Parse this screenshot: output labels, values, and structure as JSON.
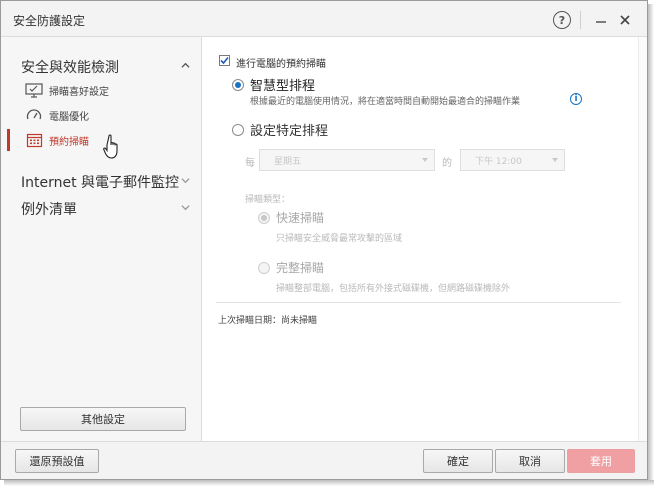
{
  "window": {
    "title": "安全防護設定"
  },
  "sidebar": {
    "sections": [
      {
        "label": "安全與效能檢測",
        "expanded": true,
        "items": [
          {
            "label": "掃瞄喜好設定",
            "icon": "monitor-icon"
          },
          {
            "label": "電腦優化",
            "icon": "gauge-icon"
          },
          {
            "label": "預約掃瞄",
            "icon": "calendar-icon",
            "active": true
          }
        ]
      },
      {
        "label": "Internet 與電子郵件監控",
        "expanded": false
      },
      {
        "label": "例外清單",
        "expanded": false
      }
    ],
    "other_settings_label": "其他設定"
  },
  "main": {
    "enable_schedule_label": "進行電腦的預約掃瞄",
    "enable_schedule_checked": true,
    "smart_schedule_label": "智慧型排程",
    "smart_schedule_selected": true,
    "smart_schedule_desc": "根據最近的電腦使用情況，將在適當時間自動開始最適合的掃瞄作業",
    "specific_schedule_label": "設定特定排程",
    "every_label": "每",
    "day_value": "星期五",
    "at_label": "的",
    "time_value": "下午 12:00",
    "scan_type_label": "掃瞄類型：",
    "quick_scan_label": "快速掃瞄",
    "quick_scan_desc": "只掃瞄安全威脅最常攻擊的區域",
    "full_scan_label": "完整掃瞄",
    "full_scan_desc": "掃瞄整部電腦，包括所有外接式磁碟機，但網路磁碟機除外",
    "last_scan": "上次掃瞄日期：尚未掃瞄"
  },
  "footer": {
    "restore_label": "還原預設值",
    "ok_label": "確定",
    "cancel_label": "取消",
    "apply_label": "套用"
  },
  "colors": {
    "accent_red": "#c0392b",
    "radio_blue": "#1a73c4",
    "apply_disabled": "#f0a0a3"
  }
}
